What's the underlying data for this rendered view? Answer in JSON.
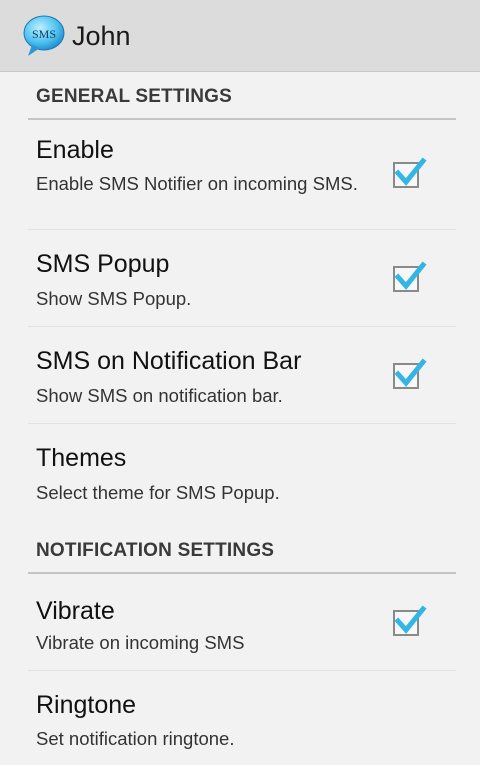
{
  "actionbar": {
    "app_icon_label": "SMS",
    "title": "John"
  },
  "sections": [
    {
      "header": "GENERAL SETTINGS",
      "items": [
        {
          "title": "Enable",
          "summary": "Enable SMS Notifier on incoming SMS.",
          "checked": true
        },
        {
          "title": "SMS Popup",
          "summary": "Show SMS Popup.",
          "checked": true
        },
        {
          "title": "SMS on Notification Bar",
          "summary": "Show SMS on notification bar.",
          "checked": true
        },
        {
          "title": "Themes",
          "summary": "Select theme for SMS Popup."
        }
      ]
    },
    {
      "header": "NOTIFICATION SETTINGS",
      "items": [
        {
          "title": "Vibrate",
          "summary": "Vibrate on incoming SMS",
          "checked": true
        },
        {
          "title": "Ringtone",
          "summary": "Set notification ringtone."
        }
      ]
    }
  ],
  "colors": {
    "check_accent": "#33b5e5",
    "actionbar_bg": "#dcdcdc",
    "page_bg": "#f2f2f2"
  },
  "icons": {
    "app_icon": "sms-bubble-icon",
    "check": "checkmark-icon"
  }
}
